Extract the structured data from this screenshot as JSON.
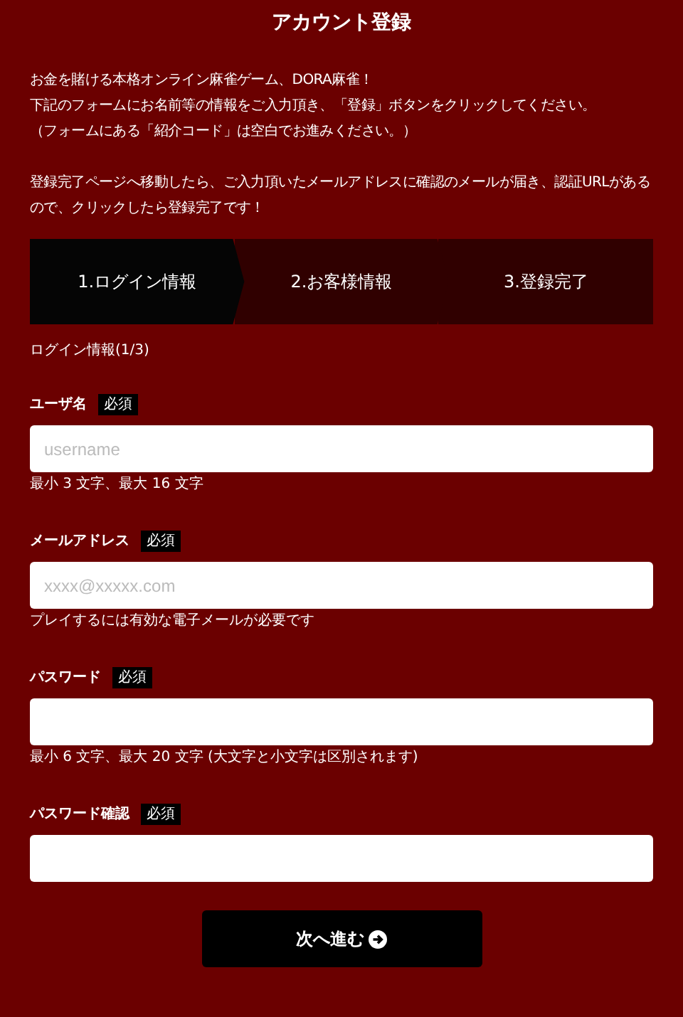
{
  "title": "アカウント登録",
  "intro": [
    "お金を賭ける本格オンライン麻雀ゲーム、DORA麻雀！",
    "下記のフォームにお名前等の情報をご入力頂き、「登録」ボタンをクリックしてください。",
    "（フォームにある「紹介コード」は空白でお進みください。）"
  ],
  "notice": "登録完了ページへ移動したら、ご入力頂いたメールアドレスに確認のメールが届き、認証URLがあるので、クリックしたら登録完了です！",
  "steps": [
    {
      "label": "1.ログイン情報",
      "selected": true
    },
    {
      "label": "2.お客様情報",
      "selected": false
    },
    {
      "label": "3.登録完了",
      "selected": false
    }
  ],
  "section": "ログイン情報(1/3)",
  "fields": [
    {
      "label": "ユーザ名",
      "badge": "必須",
      "placeholder": "username",
      "hint": "最小 3 文字、最大 16 文字"
    },
    {
      "label": "メールアドレス",
      "badge": "必須",
      "placeholder": "xxxx@xxxxx.com",
      "hint": "プレイするには有効な電子メールが必要です"
    },
    {
      "label": "パスワード",
      "badge": "必須",
      "hint": "最小 6 文字、最大 20 文字 (大文字と小文字は区別されます)"
    },
    {
      "label": "パスワード確認",
      "badge": "必須"
    }
  ],
  "button": "次へ進む"
}
